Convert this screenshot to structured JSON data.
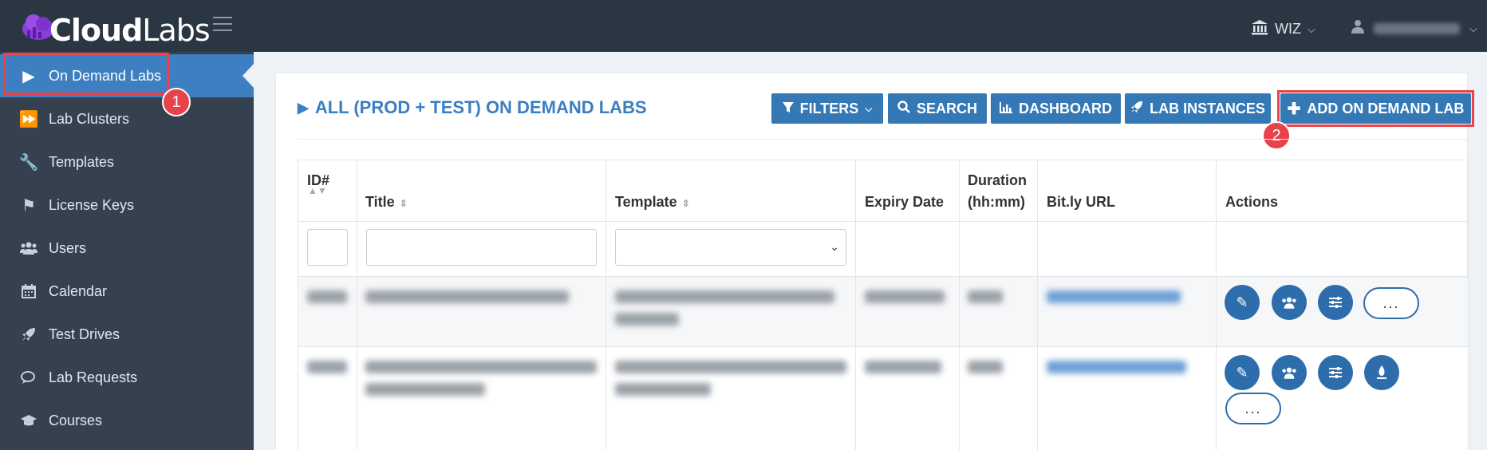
{
  "app": {
    "logo_bold": "Cloud",
    "logo_thin": "Labs"
  },
  "topbar": {
    "org_label": "WIZ"
  },
  "sidebar": {
    "items": [
      {
        "label": "On Demand Labs",
        "icon": "play-icon",
        "active": true
      },
      {
        "label": "Lab Clusters",
        "icon": "fast-forward-icon"
      },
      {
        "label": "Templates",
        "icon": "wrench-icon"
      },
      {
        "label": "License Keys",
        "icon": "tag-icon"
      },
      {
        "label": "Users",
        "icon": "users-icon"
      },
      {
        "label": "Calendar",
        "icon": "calendar-icon"
      },
      {
        "label": "Test Drives",
        "icon": "rocket-icon"
      },
      {
        "label": "Lab Requests",
        "icon": "chat-icon"
      },
      {
        "label": "Courses",
        "icon": "graduation-cap-icon"
      }
    ]
  },
  "annotations": {
    "badge1": "1",
    "badge2": "2",
    "highlight_color": "#e8424a"
  },
  "main": {
    "title": "ALL (PROD + TEST) ON DEMAND LABS",
    "buttons": {
      "filters": "FILTERS",
      "search": "SEARCH",
      "dashboard": "DASHBOARD",
      "lab_instances": "LAB INSTANCES",
      "add": "ADD ON DEMAND LAB"
    },
    "table": {
      "headers": {
        "id": "ID#",
        "title": "Title",
        "template": "Template",
        "expiry": "Expiry Date",
        "duration_line1": "Duration",
        "duration_line2": "(hh:mm)",
        "bitly": "Bit.ly URL",
        "actions": "Actions"
      },
      "more_label": "..."
    }
  },
  "colors": {
    "accent": "#3478b6",
    "sidebar": "#364150",
    "topbar": "#2b3643"
  }
}
